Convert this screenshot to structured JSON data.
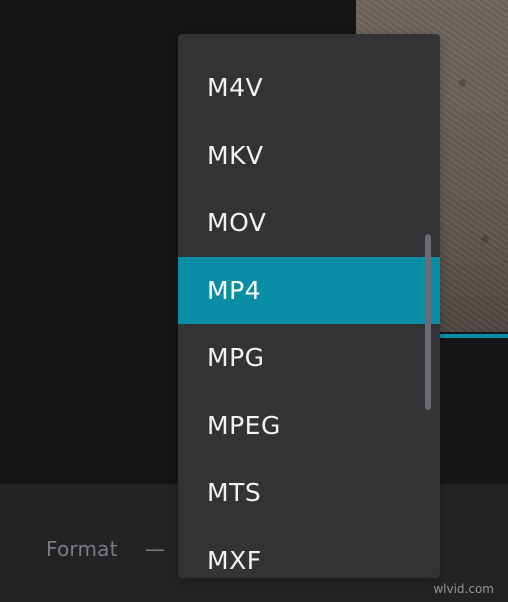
{
  "format_row": {
    "label": "Format",
    "separator": "—"
  },
  "dropdown": {
    "items": [
      {
        "label": "M4V"
      },
      {
        "label": "MKV"
      },
      {
        "label": "MOV"
      },
      {
        "label": "MP4"
      },
      {
        "label": "MPG"
      },
      {
        "label": "MPEG"
      },
      {
        "label": "MTS"
      },
      {
        "label": "MXF"
      }
    ],
    "selected_index": 3
  },
  "colors": {
    "accent": "#0a8ea5",
    "dropdown_bg": "#333336",
    "page_bg": "#151517",
    "bottom_bar_bg": "#232326",
    "label_color": "#7b7b80"
  },
  "watermark": {
    "text": "wlvid.com"
  }
}
